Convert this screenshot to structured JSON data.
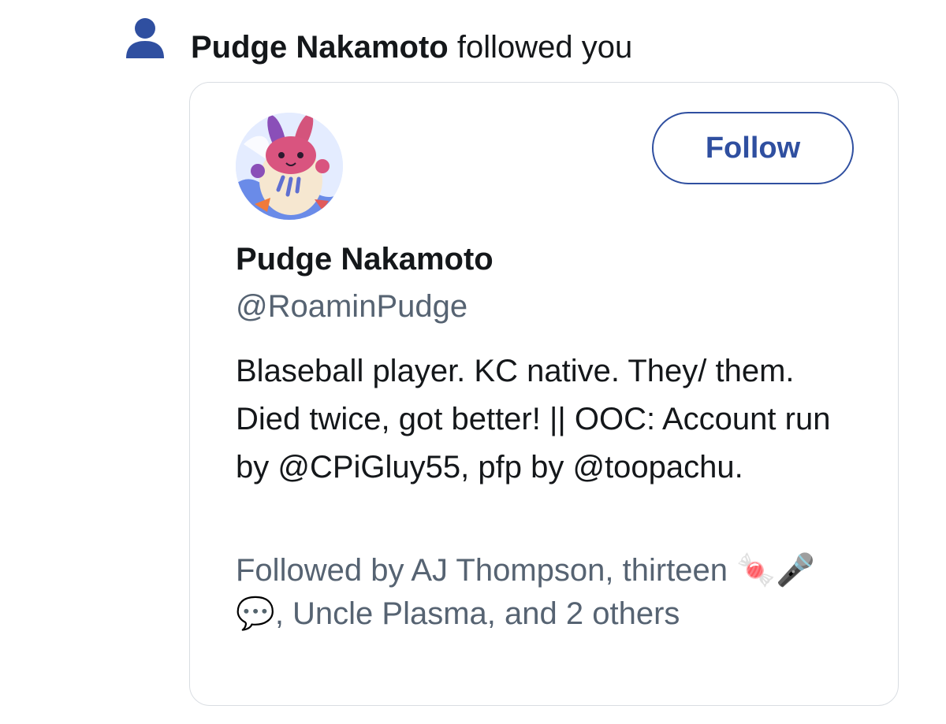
{
  "notification": {
    "icon": "person-icon",
    "actor_name": "Pudge Nakamoto",
    "action_text": " followed you"
  },
  "profile_card": {
    "avatar_icon": "avatar-rabbit-character",
    "follow_button_label": "Follow",
    "display_name": "Pudge Nakamoto",
    "handle": "@RoaminPudge",
    "bio": "Blaseball player. KC native. They/ them. Died twice, got better! || OOC: Account run by @CPiGluy55, pfp by @toopachu.",
    "followed_by_prefix": "Followed by AJ Thompson, thirteen ",
    "followed_by_emoji": "🍬🎤💬",
    "followed_by_suffix": ", Uncle Plasma, and 2 others"
  },
  "colors": {
    "accent": "#2f4fa0",
    "text_primary": "#14171a",
    "text_secondary": "#566372",
    "card_border": "#d9dde2"
  }
}
